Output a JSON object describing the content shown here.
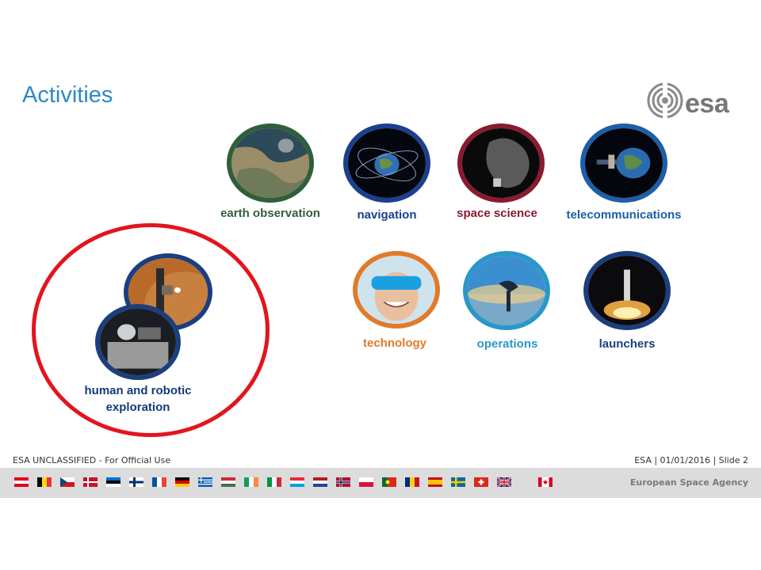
{
  "title": "Activities",
  "logo": {
    "text": "esa",
    "icon": "esa-logo-icon"
  },
  "activities": [
    {
      "id": "earth",
      "label": "earth observation",
      "color": "#2f5f3a"
    },
    {
      "id": "navigation",
      "label": "navigation",
      "color": "#1c3f8f"
    },
    {
      "id": "space-science",
      "label": "space science",
      "color": "#8b1a2e"
    },
    {
      "id": "telecom",
      "label": "telecommunications",
      "color": "#1d5ea8"
    },
    {
      "id": "technology",
      "label": "technology",
      "color": "#e07b2a"
    },
    {
      "id": "operations",
      "label": "operations",
      "color": "#2a97c9"
    },
    {
      "id": "launchers",
      "label": "launchers",
      "color": "#1b3f7e"
    }
  ],
  "highlight": {
    "line1": "human and robotic",
    "line2": "exploration",
    "ring_color": "#e3141d"
  },
  "footer": {
    "classification": "ESA UNCLASSIFIED - For Official Use",
    "slide_info": "ESA | 01/01/2016 | Slide  2",
    "agency": "European Space Agency"
  }
}
